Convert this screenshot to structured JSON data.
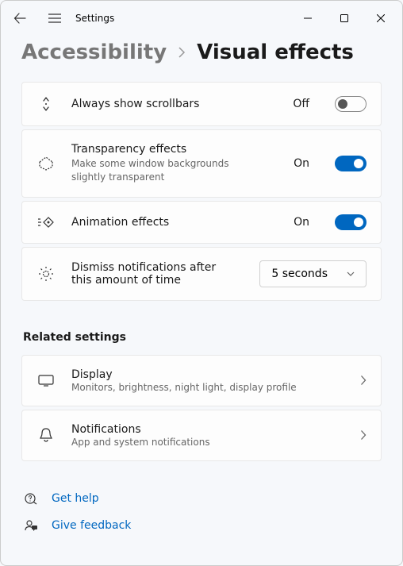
{
  "window": {
    "title": "Settings"
  },
  "breadcrumb": {
    "parent": "Accessibility",
    "current": "Visual effects"
  },
  "settings": {
    "scrollbars": {
      "title": "Always show scrollbars",
      "state": "Off"
    },
    "transparency": {
      "title": "Transparency effects",
      "desc": "Make some window backgrounds slightly transparent",
      "state": "On"
    },
    "animation": {
      "title": "Animation effects",
      "state": "On"
    },
    "dismiss": {
      "title": "Dismiss notifications after this amount of time",
      "value": "5 seconds"
    }
  },
  "related": {
    "heading": "Related settings",
    "display": {
      "title": "Display",
      "desc": "Monitors, brightness, night light, display profile"
    },
    "notifications": {
      "title": "Notifications",
      "desc": "App and system notifications"
    }
  },
  "footer": {
    "help": "Get help",
    "feedback": "Give feedback"
  }
}
